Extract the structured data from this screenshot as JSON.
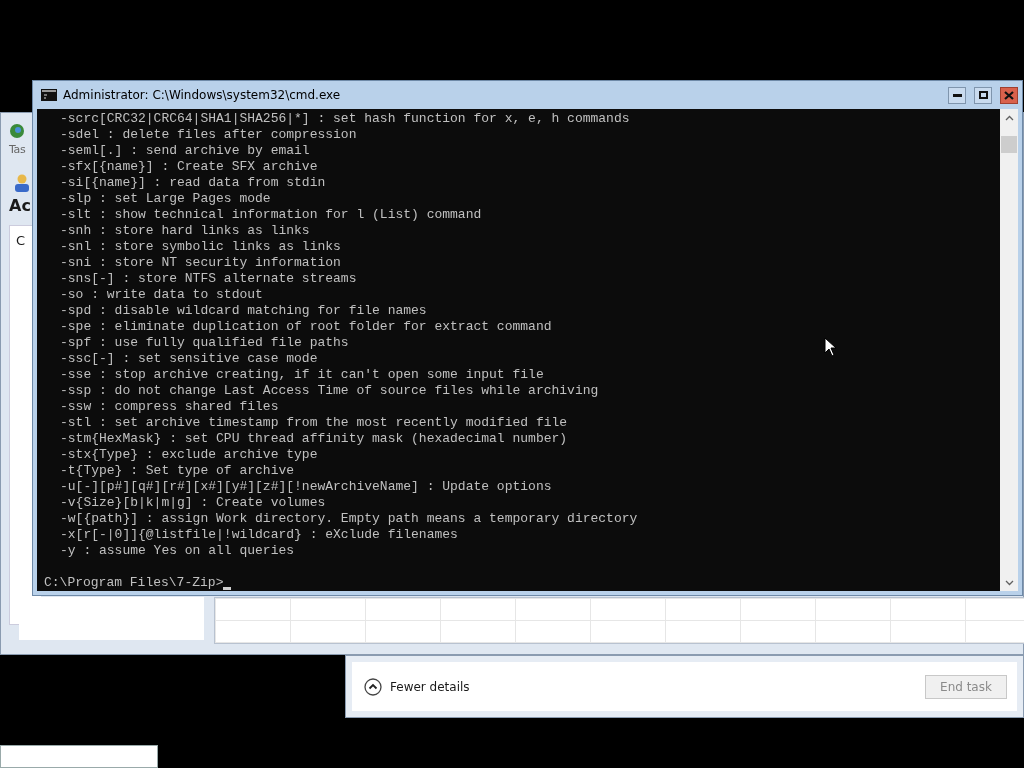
{
  "background_window": {
    "tab_label": "Tas",
    "heading": "Ac",
    "column_label": "C"
  },
  "footer": {
    "toggle_label": "Fewer details",
    "end_task": {
      "label": "End task",
      "disabled": true
    }
  },
  "console": {
    "title": "Administrator: C:\\Windows\\system32\\cmd.exe",
    "lines": [
      {
        "kind": "option",
        "text": "-scrc[CRC32|CRC64|SHA1|SHA256|*] : set hash function for x, e, h commands"
      },
      {
        "kind": "option",
        "text": "-sdel : delete files after compression"
      },
      {
        "kind": "option",
        "text": "-seml[.] : send archive by email"
      },
      {
        "kind": "option",
        "text": "-sfx[{name}] : Create SFX archive"
      },
      {
        "kind": "option",
        "text": "-si[{name}] : read data from stdin"
      },
      {
        "kind": "option",
        "text": "-slp : set Large Pages mode"
      },
      {
        "kind": "option",
        "text": "-slt : show technical information for l (List) command"
      },
      {
        "kind": "option",
        "text": "-snh : store hard links as links"
      },
      {
        "kind": "option",
        "text": "-snl : store symbolic links as links"
      },
      {
        "kind": "option",
        "text": "-sni : store NT security information"
      },
      {
        "kind": "option",
        "text": "-sns[-] : store NTFS alternate streams"
      },
      {
        "kind": "option",
        "text": "-so : write data to stdout"
      },
      {
        "kind": "option",
        "text": "-spd : disable wildcard matching for file names"
      },
      {
        "kind": "option",
        "text": "-spe : eliminate duplication of root folder for extract command"
      },
      {
        "kind": "option",
        "text": "-spf : use fully qualified file paths"
      },
      {
        "kind": "option",
        "text": "-ssc[-] : set sensitive case mode"
      },
      {
        "kind": "option",
        "text": "-sse : stop archive creating, if it can't open some input file"
      },
      {
        "kind": "option",
        "text": "-ssp : do not change Last Access Time of source files while archiving"
      },
      {
        "kind": "option",
        "text": "-ssw : compress shared files"
      },
      {
        "kind": "option",
        "text": "-stl : set archive timestamp from the most recently modified file"
      },
      {
        "kind": "option",
        "text": "-stm{HexMask} : set CPU thread affinity mask (hexadecimal number)"
      },
      {
        "kind": "option",
        "text": "-stx{Type} : exclude archive type"
      },
      {
        "kind": "option",
        "text": "-t{Type} : Set type of archive"
      },
      {
        "kind": "option",
        "text": "-u[-][p#][q#][r#][x#][y#][z#][!newArchiveName] : Update options"
      },
      {
        "kind": "option",
        "text": "-v{Size}[b|k|m|g] : Create volumes"
      },
      {
        "kind": "option",
        "text": "-w[{path}] : assign Work directory. Empty path means a temporary directory"
      },
      {
        "kind": "option",
        "text": "-x[r[-|0]]{@listfile|!wildcard} : eXclude filenames"
      },
      {
        "kind": "option",
        "text": "-y : assume Yes on all queries"
      },
      {
        "kind": "blank"
      },
      {
        "kind": "prompt",
        "text": "C:\\Program Files\\7-Zip>"
      }
    ]
  }
}
